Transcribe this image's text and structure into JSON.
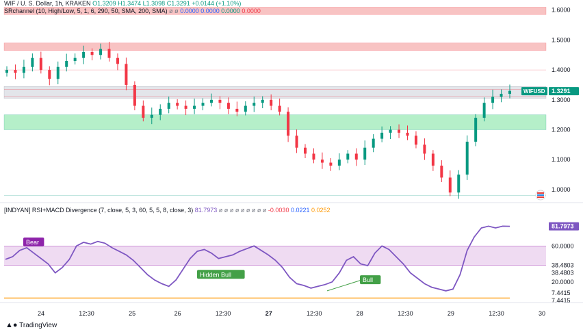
{
  "header": {
    "symbol_line": "WIF / U. S. Dollar, 1h, KRAKEN",
    "ohlc": [
      "O1.3209",
      "H1.3474",
      "L1.3098",
      "C1.3291",
      "+0.0144 (+1.10%)"
    ],
    "sr_label": "SRchannel (10, High/Low, 5, 1, 6, 290, 50, SMA, 200, SMA)",
    "sr_values": [
      "ø",
      "ø",
      "0.0000",
      "0.0000",
      "0.0000",
      "0.0000"
    ],
    "ind_label": "[INDYAN] RSI+MACD Divergence (7, close, 5, 3, 60, 5, 5, 8, close, 3)",
    "ind_value_main": "81.7973",
    "ind_nulls": [
      "ø",
      "ø",
      "ø",
      "ø",
      "ø",
      "ø",
      "ø",
      "ø",
      "ø"
    ],
    "ind_values": [
      "-0.0030",
      "0.0221",
      "0.0252"
    ]
  },
  "colors": {
    "up": "#089981",
    "down": "#f23645",
    "rsi": "#7e57c2",
    "resistance_zone": "#f7b8b8",
    "support_zone": "#a8ecc0",
    "price_tag": "#089981",
    "bear_label": "#8e24aa",
    "bull_label": "#43a047",
    "baseline": "#ff9800"
  },
  "chart_data": [
    {
      "type": "candlestick",
      "title": "WIF / U. S. Dollar, 1h, KRAKEN",
      "x_ticks": [
        "24",
        "12:30",
        "25",
        "26",
        "12:30",
        "27",
        "12:30",
        "28",
        "12:30",
        "29",
        "12:30",
        "30"
      ],
      "y_ticks": [
        "1.6000",
        "1.5000",
        "1.4000",
        "1.3000",
        "1.2000",
        "1.1000",
        "1.0000"
      ],
      "ylim": [
        0.97,
        1.62
      ],
      "last_price_label": "WIFUSD",
      "last_price": "1.3291",
      "zones": [
        {
          "kind": "resistance",
          "from": 1.585,
          "to": 1.61
        },
        {
          "kind": "resistance",
          "from": 1.465,
          "to": 1.49
        },
        {
          "kind": "neutral",
          "from": 1.305,
          "to": 1.345
        },
        {
          "kind": "support",
          "from": 1.2,
          "to": 1.25
        }
      ],
      "lines": [
        1.4,
        1.335,
        1.31,
        0.98
      ],
      "close_path": [
        1.4,
        1.39,
        1.41,
        1.44,
        1.4,
        1.37,
        1.41,
        1.43,
        1.44,
        1.46,
        1.45,
        1.47,
        1.44,
        1.42,
        1.35,
        1.28,
        1.24,
        1.25,
        1.27,
        1.29,
        1.28,
        1.27,
        1.28,
        1.29,
        1.3,
        1.29,
        1.27,
        1.26,
        1.28,
        1.29,
        1.3,
        1.28,
        1.26,
        1.18,
        1.14,
        1.12,
        1.1,
        1.09,
        1.08,
        1.1,
        1.12,
        1.1,
        1.14,
        1.17,
        1.19,
        1.2,
        1.19,
        1.18,
        1.15,
        1.12,
        1.08,
        1.04,
        0.99,
        1.05,
        1.16,
        1.24,
        1.29,
        1.31,
        1.32,
        1.33
      ]
    },
    {
      "type": "line",
      "title": "[INDYAN] RSI+MACD Divergence",
      "y_ticks": [
        "60.0000",
        "38.4803",
        "38.4803",
        "20.0000",
        "7.4415",
        "7.4415"
      ],
      "ylim": [
        0,
        96
      ],
      "band": [
        38.48,
        60
      ],
      "last_value": "81.7973",
      "labels": [
        {
          "text": "Bear",
          "kind": "bear"
        },
        {
          "text": "Hidden Bull",
          "kind": "bull"
        },
        {
          "text": "Bull",
          "kind": "bull"
        }
      ],
      "values": [
        45,
        48,
        55,
        58,
        52,
        46,
        40,
        30,
        36,
        45,
        60,
        64,
        62,
        65,
        63,
        58,
        54,
        50,
        44,
        36,
        28,
        22,
        18,
        15,
        22,
        34,
        46,
        54,
        56,
        52,
        46,
        48,
        50,
        54,
        57,
        60,
        55,
        50,
        44,
        36,
        25,
        18,
        16,
        13,
        15,
        17,
        20,
        30,
        44,
        48,
        40,
        38,
        52,
        60,
        56,
        48,
        40,
        30,
        24,
        18,
        14,
        12,
        10,
        12,
        28,
        55,
        70,
        80,
        82,
        80,
        82,
        81.8
      ]
    }
  ],
  "footer": {
    "brand": "TradingView"
  }
}
